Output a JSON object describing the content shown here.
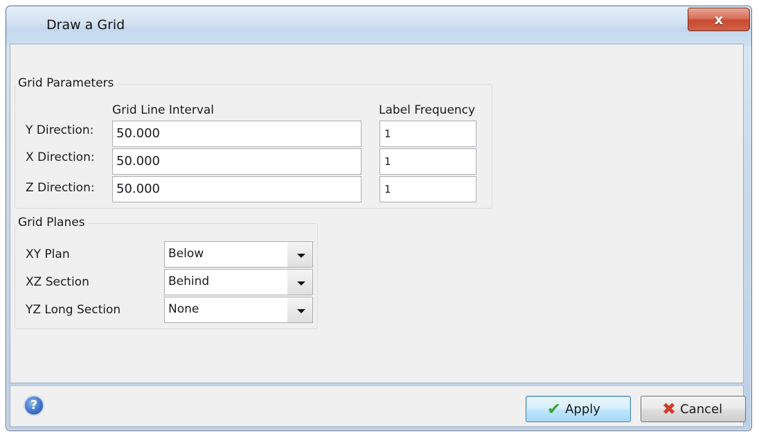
{
  "window": {
    "title": "Draw a Grid",
    "close_label": "x"
  },
  "grid_parameters": {
    "title": "Grid Parameters",
    "col_interval": "Grid Line Interval",
    "col_frequency": "Label Frequency",
    "rows": [
      {
        "label": "Y Direction:",
        "interval": "50.000",
        "frequency": "1"
      },
      {
        "label": "X Direction:",
        "interval": "50.000",
        "frequency": "1"
      },
      {
        "label": "Z Direction:",
        "interval": "50.000",
        "frequency": "1"
      }
    ]
  },
  "grid_planes": {
    "title": "Grid Planes",
    "rows": [
      {
        "label": "XY Plan",
        "value": "Below"
      },
      {
        "label": "XZ Section",
        "value": "Behind"
      },
      {
        "label": "YZ Long Section",
        "value": "None"
      }
    ]
  },
  "footer": {
    "help_label": "?",
    "apply_label": "Apply",
    "cancel_label": "Cancel"
  },
  "icons": {
    "help": "help-icon",
    "apply": "checkmark-icon",
    "cancel": "cross-icon",
    "combo_arrow": "chevron-down-icon"
  },
  "colors": {
    "title_bar": "#c9daeb",
    "close_button": "#c8482e",
    "client_bg": "#f0f0f0",
    "apply_border": "#3c7fb1",
    "check": "#3aa33a",
    "cross": "#d33b2a"
  }
}
